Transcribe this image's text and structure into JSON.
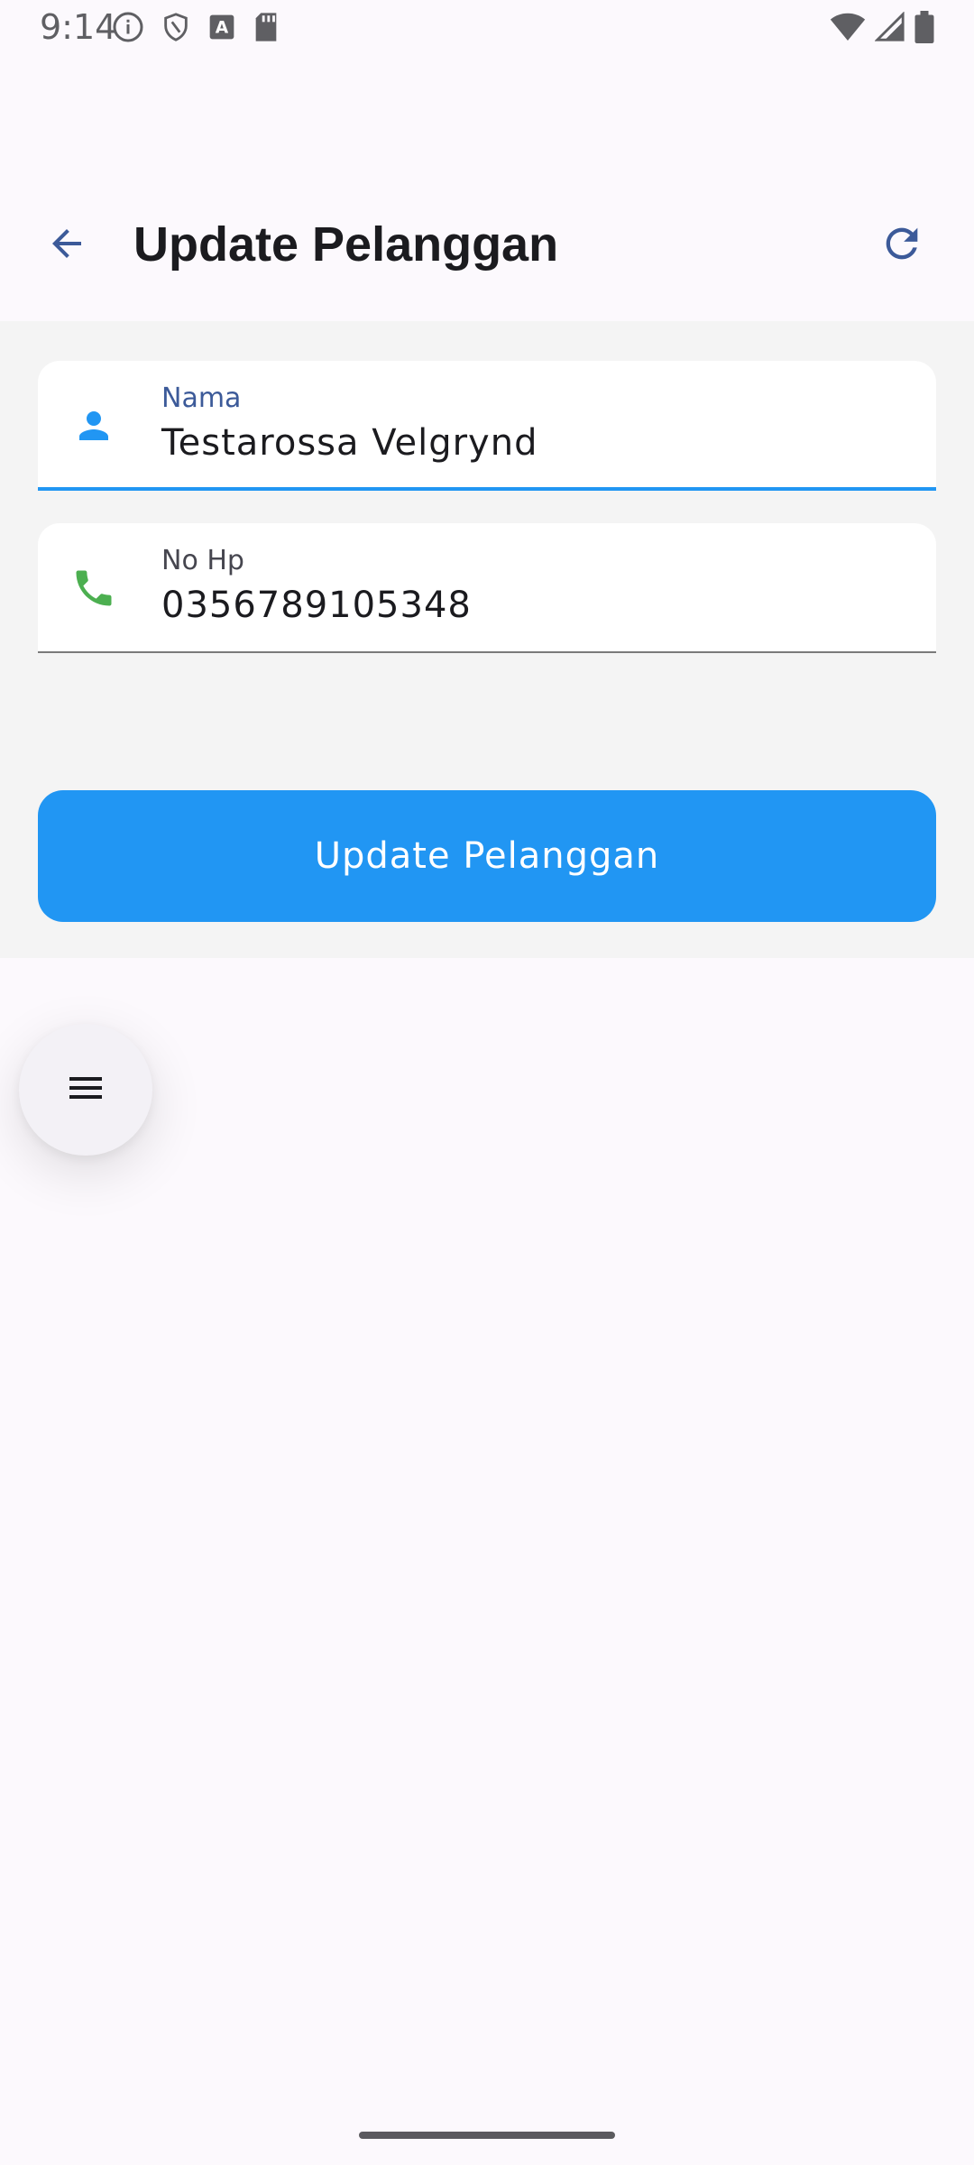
{
  "status_bar": {
    "time": "9:14",
    "icons_left": [
      "info-icon",
      "shield-icon",
      "text-a-icon",
      "sd-card-icon"
    ],
    "icons_right": [
      "wifi-icon",
      "cell-signal-icon",
      "battery-icon"
    ]
  },
  "appbar": {
    "title": "Update Pelanggan",
    "back_icon": "arrow-back-icon",
    "refresh_icon": "refresh-icon"
  },
  "form": {
    "nama": {
      "label": "Nama",
      "value": "Testarossa Velgrynd",
      "icon": "person-icon",
      "icon_color": "#2196f3"
    },
    "no_hp": {
      "label": "No Hp",
      "value": "0356789105348",
      "icon": "phone-icon",
      "icon_color": "#4caf50"
    },
    "submit_label": "Update Pelanggan"
  },
  "fab": {
    "icon": "menu-icon"
  },
  "colors": {
    "accent": "#2196f3",
    "appbar_icon": "#3c5a99",
    "phone_green": "#4caf50"
  }
}
